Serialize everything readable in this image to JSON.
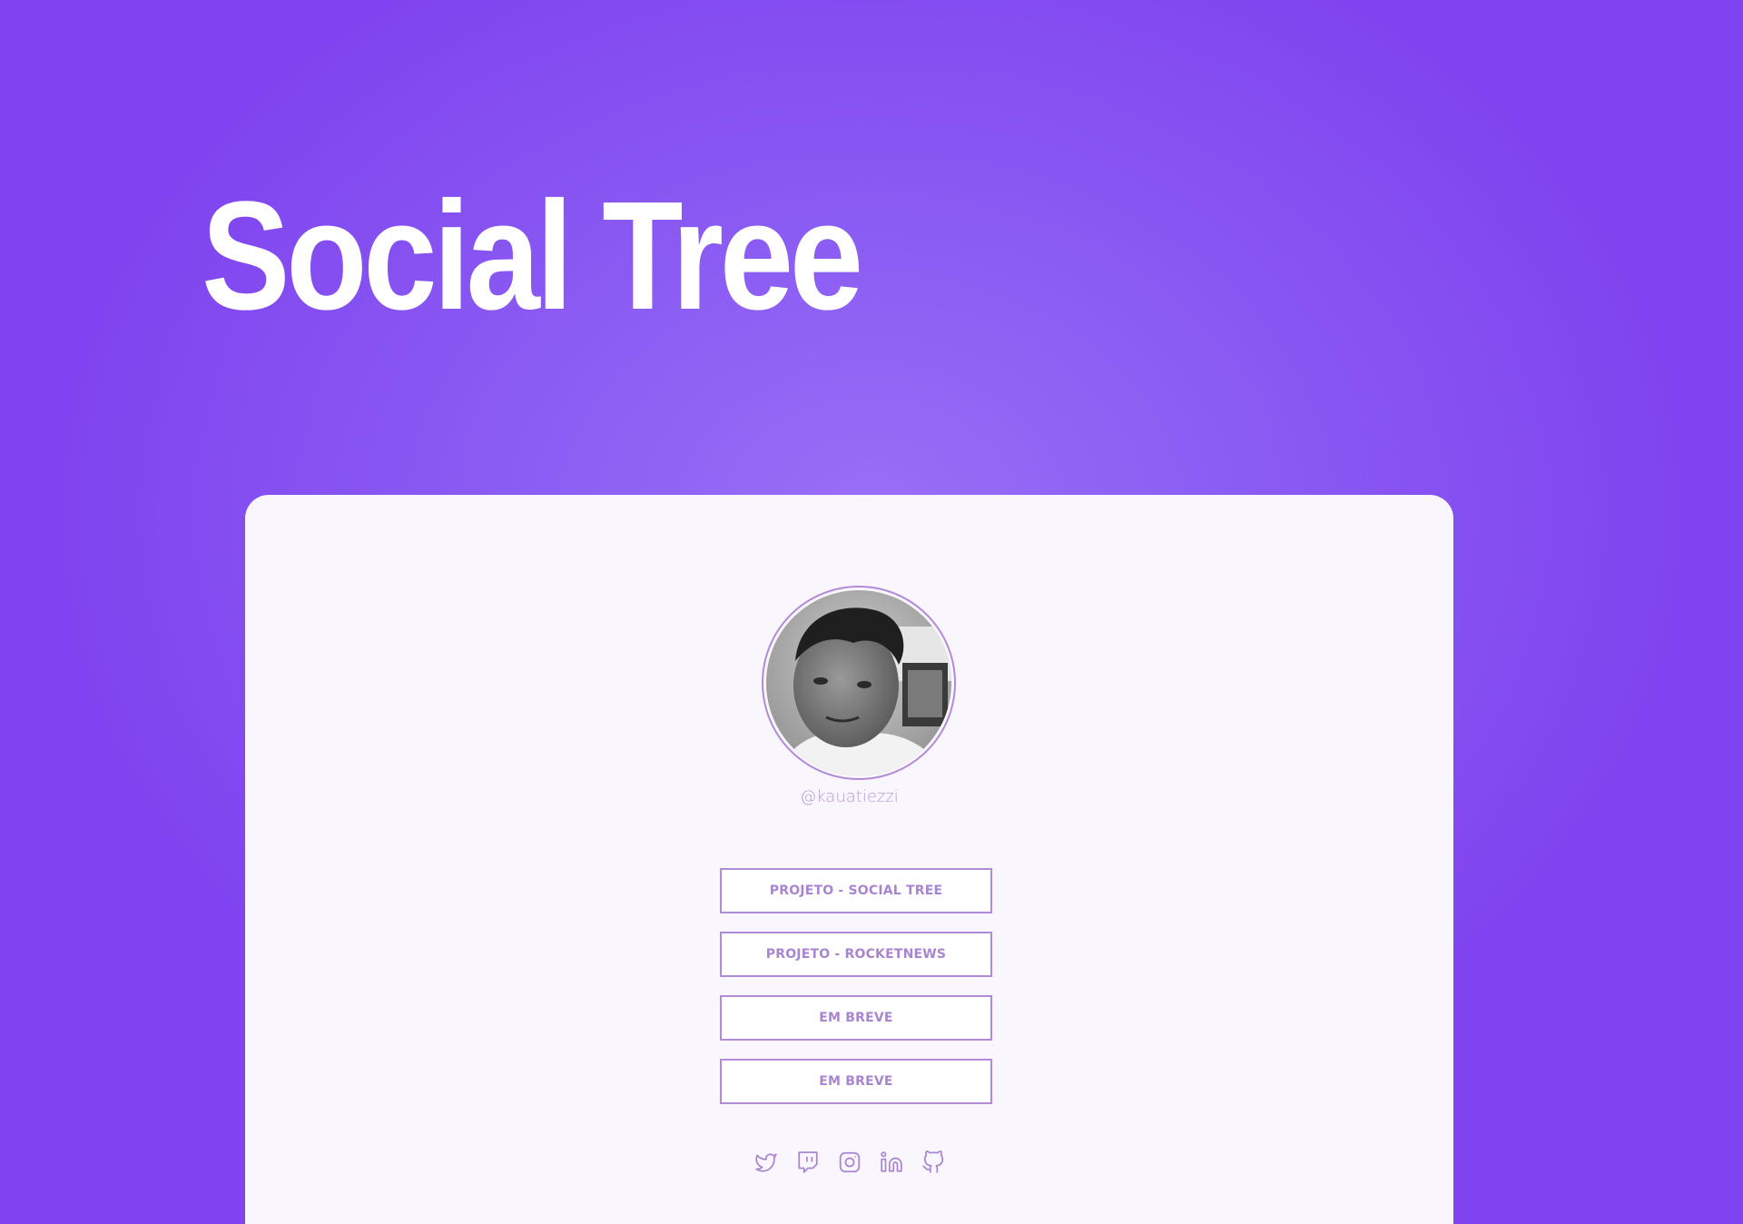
{
  "page": {
    "title": "Social Tree"
  },
  "profile": {
    "username": "@kauatiezzi",
    "avatar_alt": "profile photo"
  },
  "links": [
    {
      "label": "PROJETO - SOCIAL TREE"
    },
    {
      "label": "PROJETO - ROCKETNEWS"
    },
    {
      "label": "EM BREVE"
    },
    {
      "label": "EM BREVE"
    }
  ],
  "socials": [
    {
      "icon": "twitter-icon"
    },
    {
      "icon": "twitch-icon"
    },
    {
      "icon": "instagram-icon"
    },
    {
      "icon": "linkedin-icon"
    },
    {
      "icon": "github-icon"
    }
  ],
  "colors": {
    "background": "#8b5cf3",
    "card": "#f9f6fd",
    "accent": "#b18ad8",
    "button_text": "#a985d1",
    "title": "#ffffff"
  }
}
